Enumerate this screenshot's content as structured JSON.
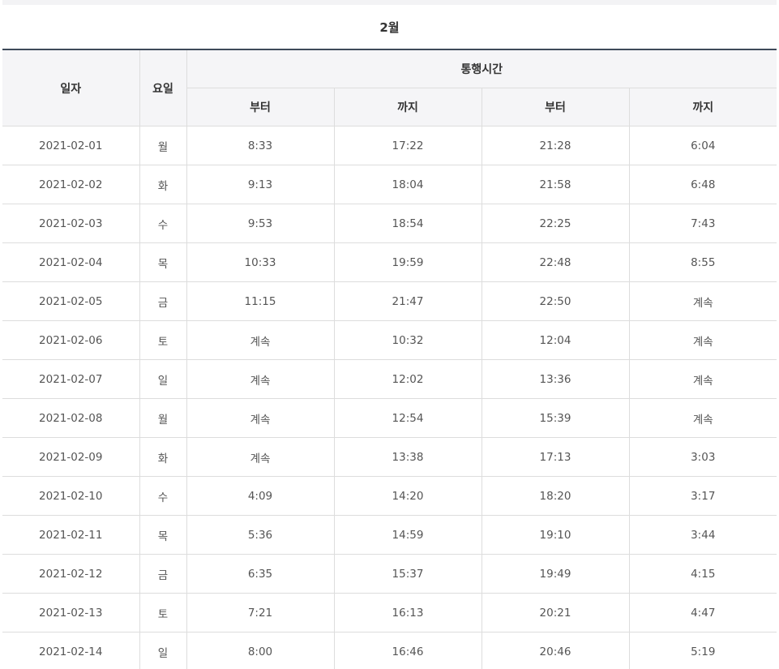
{
  "caption": "2월",
  "headers": {
    "date": "일자",
    "weekday": "요일",
    "time_group": "통행시간",
    "sub": [
      "부터",
      "까지",
      "부터",
      "까지"
    ]
  },
  "rows": [
    {
      "date": "2021-02-01",
      "day": "월",
      "t": [
        "8:33",
        "17:22",
        "21:28",
        "6:04"
      ]
    },
    {
      "date": "2021-02-02",
      "day": "화",
      "t": [
        "9:13",
        "18:04",
        "21:58",
        "6:48"
      ]
    },
    {
      "date": "2021-02-03",
      "day": "수",
      "t": [
        "9:53",
        "18:54",
        "22:25",
        "7:43"
      ]
    },
    {
      "date": "2021-02-04",
      "day": "목",
      "t": [
        "10:33",
        "19:59",
        "22:48",
        "8:55"
      ]
    },
    {
      "date": "2021-02-05",
      "day": "금",
      "t": [
        "11:15",
        "21:47",
        "22:50",
        "계속"
      ]
    },
    {
      "date": "2021-02-06",
      "day": "토",
      "t": [
        "계속",
        "10:32",
        "12:04",
        "계속"
      ]
    },
    {
      "date": "2021-02-07",
      "day": "일",
      "t": [
        "계속",
        "12:02",
        "13:36",
        "계속"
      ]
    },
    {
      "date": "2021-02-08",
      "day": "월",
      "t": [
        "계속",
        "12:54",
        "15:39",
        "계속"
      ]
    },
    {
      "date": "2021-02-09",
      "day": "화",
      "t": [
        "계속",
        "13:38",
        "17:13",
        "3:03"
      ]
    },
    {
      "date": "2021-02-10",
      "day": "수",
      "t": [
        "4:09",
        "14:20",
        "18:20",
        "3:17"
      ]
    },
    {
      "date": "2021-02-11",
      "day": "목",
      "t": [
        "5:36",
        "14:59",
        "19:10",
        "3:44"
      ]
    },
    {
      "date": "2021-02-12",
      "day": "금",
      "t": [
        "6:35",
        "15:37",
        "19:49",
        "4:15"
      ]
    },
    {
      "date": "2021-02-13",
      "day": "토",
      "t": [
        "7:21",
        "16:13",
        "20:21",
        "4:47"
      ]
    },
    {
      "date": "2021-02-14",
      "day": "일",
      "t": [
        "8:00",
        "16:46",
        "20:46",
        "5:19"
      ]
    }
  ]
}
